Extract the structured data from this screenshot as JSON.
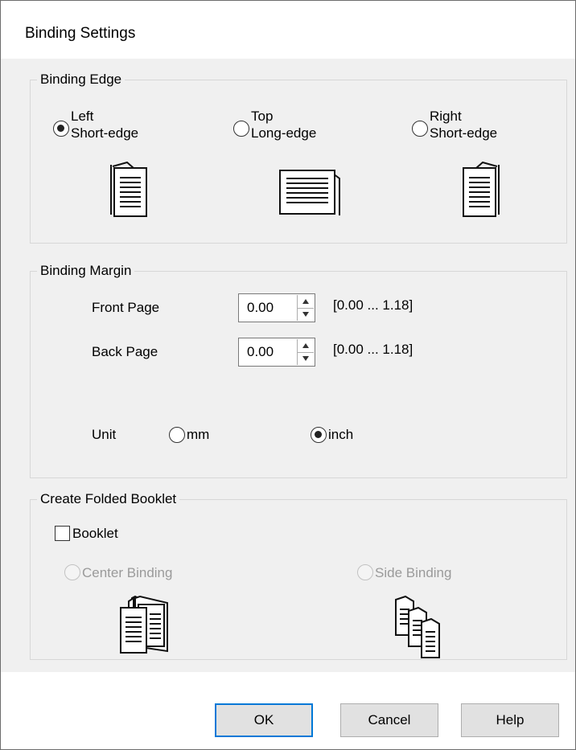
{
  "dialog": {
    "title": "Binding Settings"
  },
  "binding_edge": {
    "legend": "Binding Edge",
    "options": [
      {
        "line1": "Left",
        "line2": "Short-edge",
        "checked": true,
        "icon": "left-binding-document-icon"
      },
      {
        "line1": "Top",
        "line2": "Long-edge",
        "checked": false,
        "icon": "top-binding-document-icon"
      },
      {
        "line1": "Right",
        "line2": "Short-edge",
        "checked": false,
        "icon": "right-binding-document-icon"
      }
    ]
  },
  "binding_margin": {
    "legend": "Binding Margin",
    "front_label": "Front Page",
    "front_value": "0.00",
    "front_range": "[0.00 ... 1.18]",
    "back_label": "Back Page",
    "back_value": "0.00",
    "back_range": "[0.00 ... 1.18]",
    "unit_label": "Unit",
    "unit_mm": "mm",
    "unit_inch": "inch",
    "unit_selected": "inch"
  },
  "booklet": {
    "legend": "Create Folded Booklet",
    "checkbox_label": "Booklet",
    "checked": false,
    "center_label": "Center Binding",
    "side_label": "Side Binding"
  },
  "buttons": {
    "ok": "OK",
    "cancel": "Cancel",
    "help": "Help"
  }
}
